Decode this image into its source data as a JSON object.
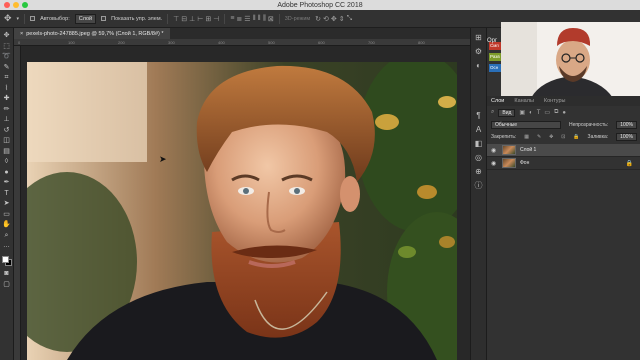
{
  "app": {
    "window_title": "Adobe Photoshop CC 2018",
    "traffic_colors": [
      "#ff5f57",
      "#ffbd2e",
      "#28c840"
    ]
  },
  "options_bar": {
    "move_icon": "move-tool-icon",
    "autoselect_label": "Автовыбор:",
    "autoselect_value": "Слой",
    "show_transform_label": "Показать упр. элем.",
    "mode_3d_label": "3D-режим"
  },
  "toolbar": {
    "tools": [
      {
        "name": "move-tool-icon",
        "glyph": "✥"
      },
      {
        "name": "marquee-tool-icon",
        "glyph": "⬚"
      },
      {
        "name": "lasso-tool-icon",
        "glyph": "➰"
      },
      {
        "name": "quick-select-icon",
        "glyph": "✎"
      },
      {
        "name": "crop-tool-icon",
        "glyph": "⌗"
      },
      {
        "name": "eyedropper-icon",
        "glyph": "⌇"
      },
      {
        "name": "healing-brush-icon",
        "glyph": "✚"
      },
      {
        "name": "brush-tool-icon",
        "glyph": "✏"
      },
      {
        "name": "stamp-tool-icon",
        "glyph": "⊥"
      },
      {
        "name": "history-brush-icon",
        "glyph": "↺"
      },
      {
        "name": "eraser-icon",
        "glyph": "◫"
      },
      {
        "name": "gradient-icon",
        "glyph": "▤"
      },
      {
        "name": "blur-icon",
        "glyph": "◊"
      },
      {
        "name": "dodge-icon",
        "glyph": "●"
      },
      {
        "name": "pen-tool-icon",
        "glyph": "✒"
      },
      {
        "name": "type-tool-icon",
        "glyph": "T"
      },
      {
        "name": "path-select-icon",
        "glyph": "➤"
      },
      {
        "name": "shape-tool-icon",
        "glyph": "▭"
      },
      {
        "name": "hand-tool-icon",
        "glyph": "✋"
      },
      {
        "name": "zoom-tool-icon",
        "glyph": "⌕"
      },
      {
        "name": "more-tools-icon",
        "glyph": "…"
      }
    ],
    "foreground_color": "#ffffff",
    "background_color": "#000000"
  },
  "document": {
    "tab_label": "pexels-photo-247885.jpeg @ 59,7% (Слой 1, RGB/8#) *",
    "close_glyph": "×"
  },
  "right_strip": {
    "icons": [
      {
        "name": "history-icon",
        "glyph": "⊞"
      },
      {
        "name": "properties-icon",
        "glyph": "⚙"
      },
      {
        "name": "adjustments-icon",
        "glyph": "◐"
      },
      {
        "name": "paragraph-icon",
        "glyph": "¶"
      },
      {
        "name": "type-icon",
        "glyph": "A"
      },
      {
        "name": "layers-icon",
        "glyph": "◧"
      },
      {
        "name": "channels-icon",
        "glyph": "◎"
      },
      {
        "name": "paths-icon",
        "glyph": "⊕"
      },
      {
        "name": "info-icon",
        "glyph": "ⓘ"
      }
    ]
  },
  "panels": {
    "swatch_labels": [
      {
        "text": "Смп",
        "color": "#c0392b"
      },
      {
        "text": "Разв",
        "color": "#7d9b2a"
      },
      {
        "text": "Осн",
        "color": "#2a6fb8"
      }
    ],
    "top_label": "Орг",
    "tabs": [
      "Слои",
      "Каналы",
      "Контуры"
    ],
    "filter_kind": "Вид",
    "blend_mode": "Обычные",
    "opacity_label": "Непрозрачность:",
    "opacity_value": "100%",
    "lock_label": "Закрепить:",
    "fill_label": "Заливка:",
    "fill_value": "100%",
    "layers": [
      {
        "name": "Слой 1",
        "active": true,
        "locked": false
      },
      {
        "name": "Фон",
        "active": false,
        "locked": true
      }
    ]
  }
}
